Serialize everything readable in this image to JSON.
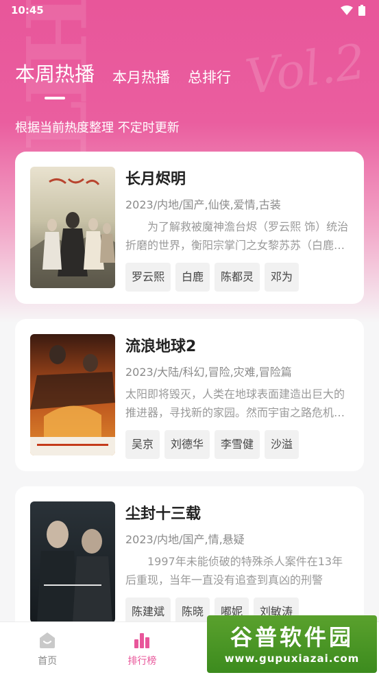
{
  "status": {
    "time": "10:45"
  },
  "tabs": [
    {
      "label": "本周热播",
      "active": true
    },
    {
      "label": "本月热播",
      "active": false
    },
    {
      "label": "总排行",
      "active": false
    }
  ],
  "subtitle": "根据当前热度整理 不定时更新",
  "items": [
    {
      "title": "长月烬明",
      "meta": "2023/内地/国产,仙侠,爱情,古装",
      "desc": "　　为了解救被魔神澹台烬（罗云熙 饰）统治折磨的世界，衡阳宗掌门之女黎苏苏（白鹿 饰）",
      "cast": [
        "罗云熙",
        "白鹿",
        "陈都灵",
        "邓为"
      ]
    },
    {
      "title": "流浪地球2",
      "meta": "2023/大陆/科幻,冒险,灾难,冒险篇",
      "desc": "太阳即将毁灭，人类在地球表面建造出巨大的推进器，寻找新的家园。然而宇宙之路危机四伏",
      "cast": [
        "吴京",
        "刘德华",
        "李雪健",
        "沙溢"
      ]
    },
    {
      "title": "尘封十三载",
      "meta": "2023/内地/国产,情,悬疑",
      "desc": "　　1997年未能侦破的特殊杀人案件在13年后重现，当年一直没有追查到真凶的刑警",
      "cast": [
        "陈建斌",
        "陈晓",
        "嘟妮",
        "刘敏涛"
      ]
    }
  ],
  "nav": [
    {
      "label": "首页",
      "icon": "home-icon",
      "active": false
    },
    {
      "label": "排行榜",
      "icon": "ranking-icon",
      "active": true
    },
    {
      "label": "",
      "icon": "",
      "active": false
    },
    {
      "label": "",
      "icon": "",
      "active": false
    }
  ],
  "watermark": {
    "title": "谷普软件园",
    "url": "www.gupuxiazai.com"
  },
  "colors": {
    "accent": "#e8569a",
    "watermark_green": "#4b9a25"
  }
}
